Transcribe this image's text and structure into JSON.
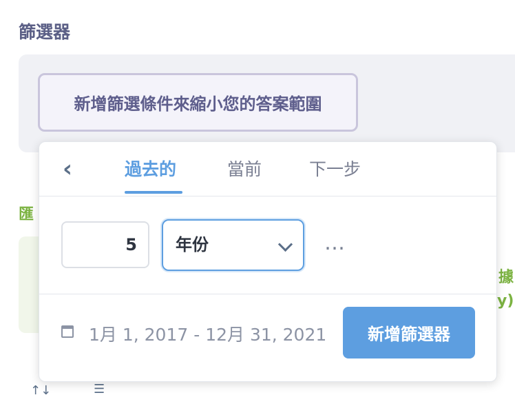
{
  "section": {
    "title": "篩選器"
  },
  "filter_bar": {
    "hint": "新增篩選條件來縮小您的答案範圍"
  },
  "background_fragments": {
    "left_green": "匯",
    "right_green": "據",
    "right_paren": "y)"
  },
  "icons": {
    "back": "chevron-left-icon",
    "chevron": "chevron-down-icon",
    "calendar": "calendar-icon",
    "more": "more-horizontal-icon",
    "sort": "sort-icon",
    "list": "list-icon"
  },
  "popover": {
    "tabs": [
      {
        "label": "過去的",
        "active": true
      },
      {
        "label": "當前",
        "active": false
      },
      {
        "label": "下一步",
        "active": false
      }
    ],
    "amount": "5",
    "unit": {
      "selected": "年份"
    },
    "more_label": "…",
    "date_range": "1月 1, 2017 - 12月 31, 2021",
    "add_button": "新增篩選器"
  },
  "colors": {
    "accent": "#5d9ee0",
    "title": "#5b5f86",
    "green": "#7cb342"
  }
}
